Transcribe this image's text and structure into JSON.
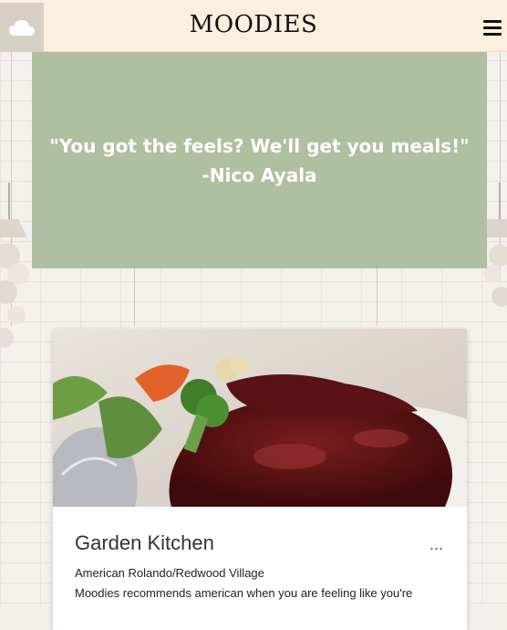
{
  "navbar": {
    "brand": "MOODIES",
    "weather_icon": "cloud-icon",
    "menu_icon": "hamburger-icon"
  },
  "hero": {
    "quote": "\"You got the feels? We'll get you meals!\"",
    "author": "-Nico Ayala"
  },
  "restaurant_card": {
    "title": "Garden Kitchen",
    "more_label": "...",
    "subtitle": "American Rolando/Redwood Village",
    "description": "Moodies recommends american when you are feeling like you're"
  },
  "colors": {
    "navbar_bg": "#fcefe0",
    "hero_bg": "#afbfa2",
    "weather_box_bg": "#d8cfc4"
  }
}
